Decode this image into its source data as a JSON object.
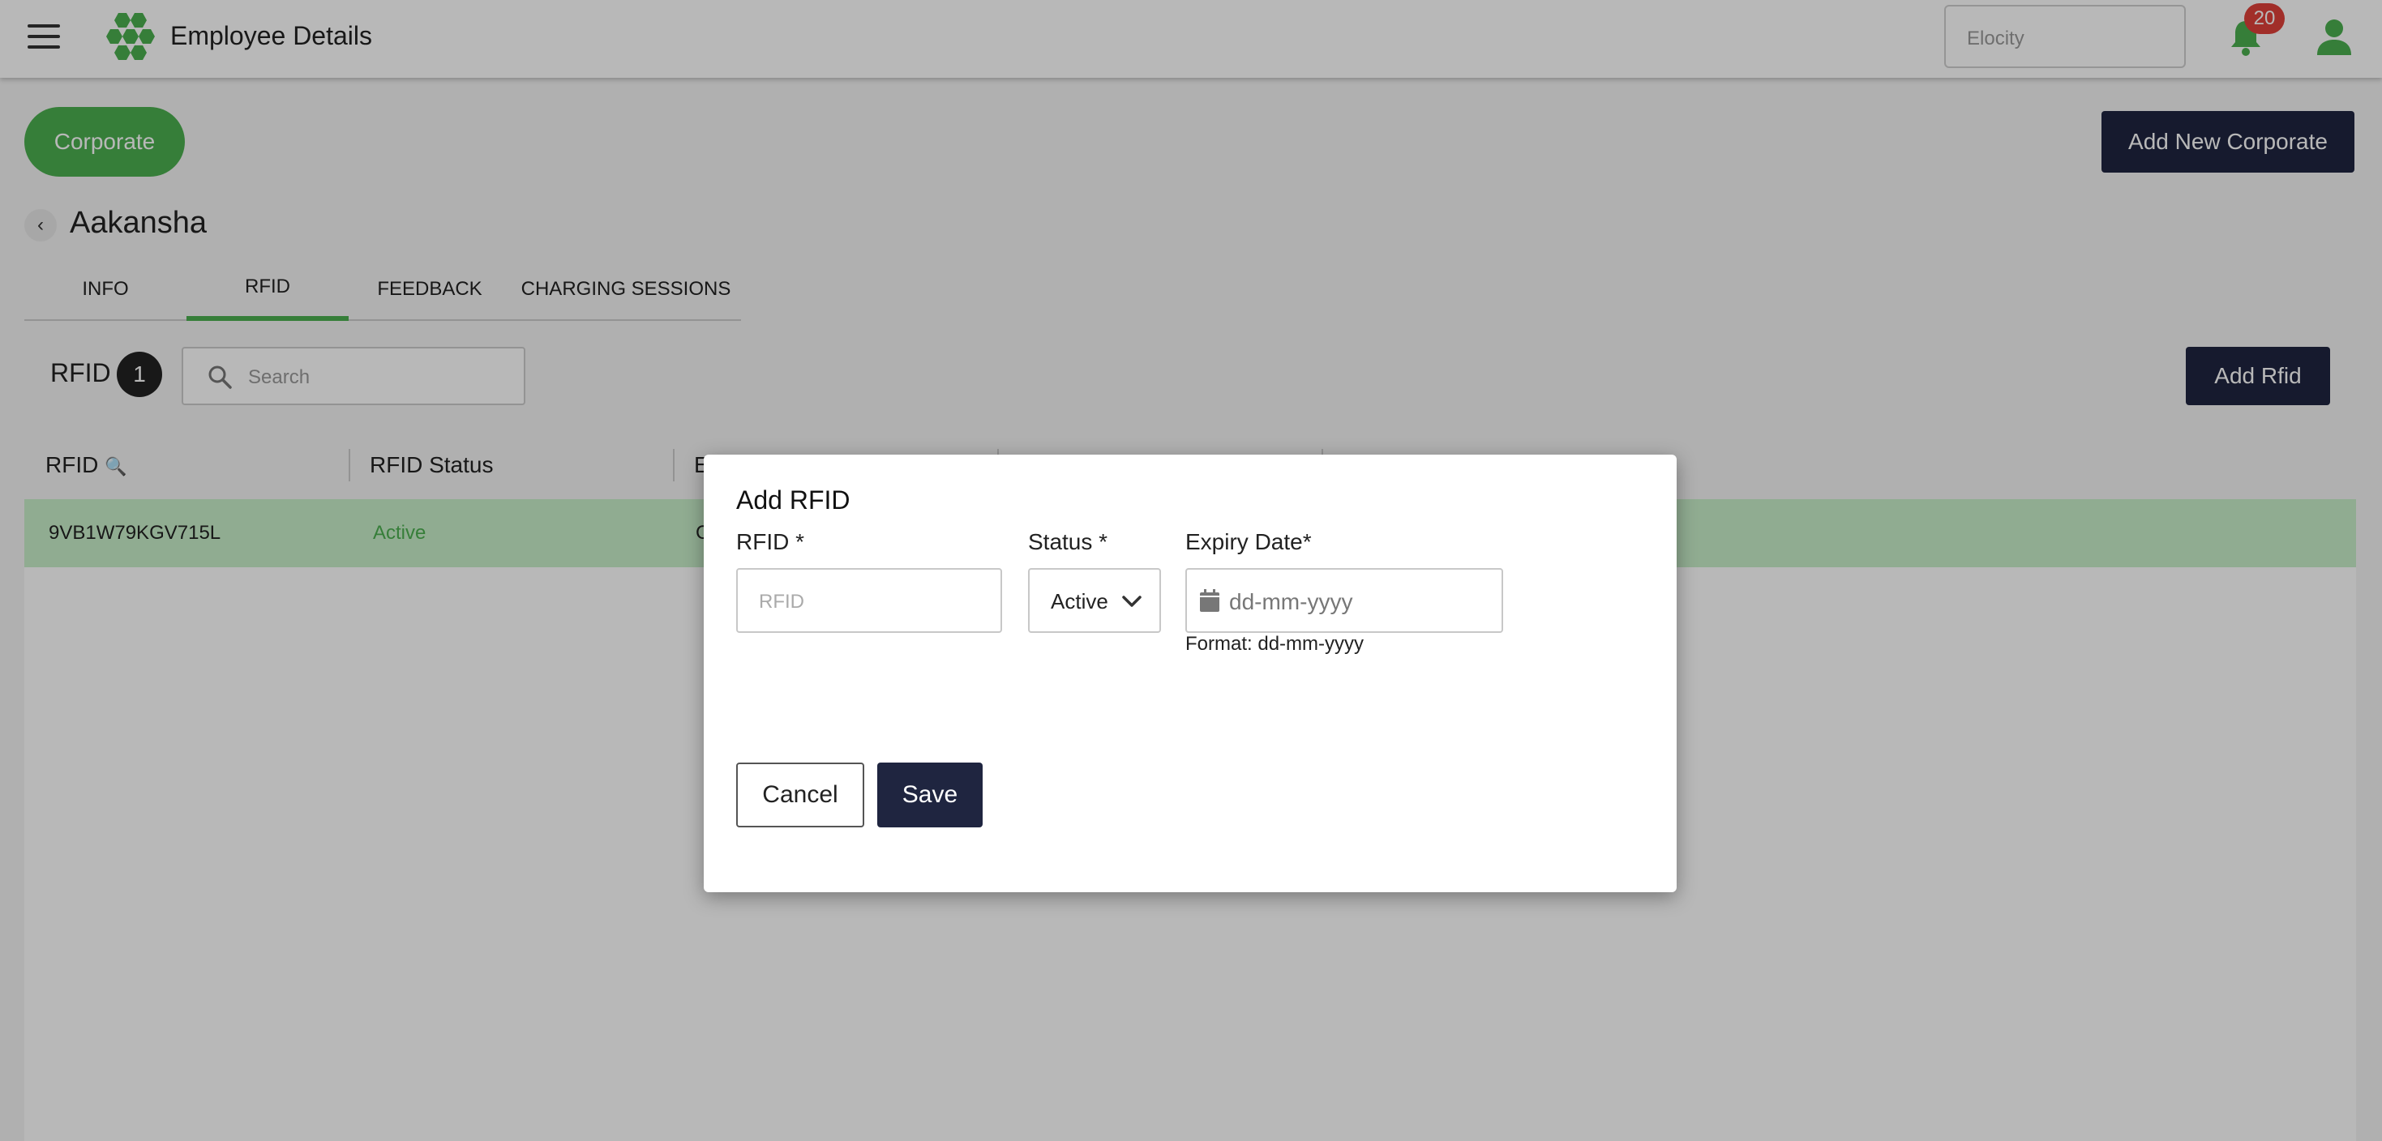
{
  "header": {
    "title": "Employee Details",
    "tenant_placeholder": "Elocity",
    "notification_count": "20",
    "colors": {
      "brand": "#4caf50",
      "dark": "#1f2540",
      "badge": "#e0403a"
    }
  },
  "page": {
    "corporate_button": "Corporate",
    "add_corporate_button": "Add New Corporate",
    "employee_name": "Aakansha",
    "tabs": [
      {
        "label": "INFO",
        "active": false
      },
      {
        "label": "RFID",
        "active": true
      },
      {
        "label": "FEEDBACK",
        "active": false
      },
      {
        "label": "CHARGING SESSIONS",
        "active": false
      }
    ]
  },
  "rfid_panel": {
    "title": "RFID",
    "count": "1",
    "search_placeholder": "Search",
    "add_button": "Add Rfid",
    "columns": [
      "RFID",
      "RFID Status",
      "E"
    ],
    "rows": [
      {
        "rfid": "9VB1W79KGV715L",
        "status": "Active",
        "third": "C"
      }
    ]
  },
  "modal": {
    "title": "Add RFID",
    "rfid_label": "RFID *",
    "rfid_placeholder": "RFID",
    "status_label": "Status *",
    "status_value": "Active",
    "expiry_label": "Expiry Date*",
    "expiry_placeholder": "dd-mm-yyyy",
    "format_hint": "Format: dd-mm-yyyy",
    "cancel": "Cancel",
    "save": "Save"
  }
}
